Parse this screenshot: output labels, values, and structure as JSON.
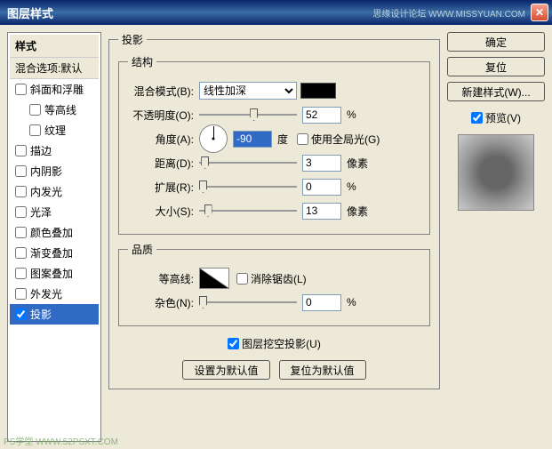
{
  "window": {
    "title": "图层样式",
    "watermark": "思缘设计论坛  WWW.MISSYUAN.COM"
  },
  "sidebar": {
    "header": "样式",
    "sub": "混合选项:默认",
    "items": [
      {
        "label": "斜面和浮雕",
        "checked": false
      },
      {
        "label": "等高线",
        "checked": false,
        "indent": true
      },
      {
        "label": "纹理",
        "checked": false,
        "indent": true
      },
      {
        "label": "描边",
        "checked": false
      },
      {
        "label": "内阴影",
        "checked": false
      },
      {
        "label": "内发光",
        "checked": false
      },
      {
        "label": "光泽",
        "checked": false
      },
      {
        "label": "颜色叠加",
        "checked": false
      },
      {
        "label": "渐变叠加",
        "checked": false
      },
      {
        "label": "图案叠加",
        "checked": false
      },
      {
        "label": "外发光",
        "checked": false
      },
      {
        "label": "投影",
        "checked": true,
        "selected": true
      }
    ]
  },
  "panel": {
    "title": "投影",
    "structure": {
      "legend": "结构",
      "blend_label": "混合模式(B):",
      "blend_value": "线性加深",
      "opacity_label": "不透明度(O):",
      "opacity_value": "52",
      "opacity_unit": "%",
      "angle_label": "角度(A):",
      "angle_value": "-90",
      "angle_unit": "度",
      "global_light": "使用全局光(G)",
      "distance_label": "距离(D):",
      "distance_value": "3",
      "distance_unit": "像素",
      "spread_label": "扩展(R):",
      "spread_value": "0",
      "spread_unit": "%",
      "size_label": "大小(S):",
      "size_value": "13",
      "size_unit": "像素"
    },
    "quality": {
      "legend": "品质",
      "contour_label": "等高线:",
      "antialias": "消除锯齿(L)",
      "noise_label": "杂色(N):",
      "noise_value": "0",
      "noise_unit": "%"
    },
    "knockout": "图层挖空投影(U)",
    "make_default": "设置为默认值",
    "reset_default": "复位为默认值"
  },
  "right": {
    "ok": "确定",
    "cancel": "复位",
    "newstyle": "新建样式(W)...",
    "preview": "预览(V)"
  },
  "footer": "PS学堂  WWW.52PSXT.COM"
}
